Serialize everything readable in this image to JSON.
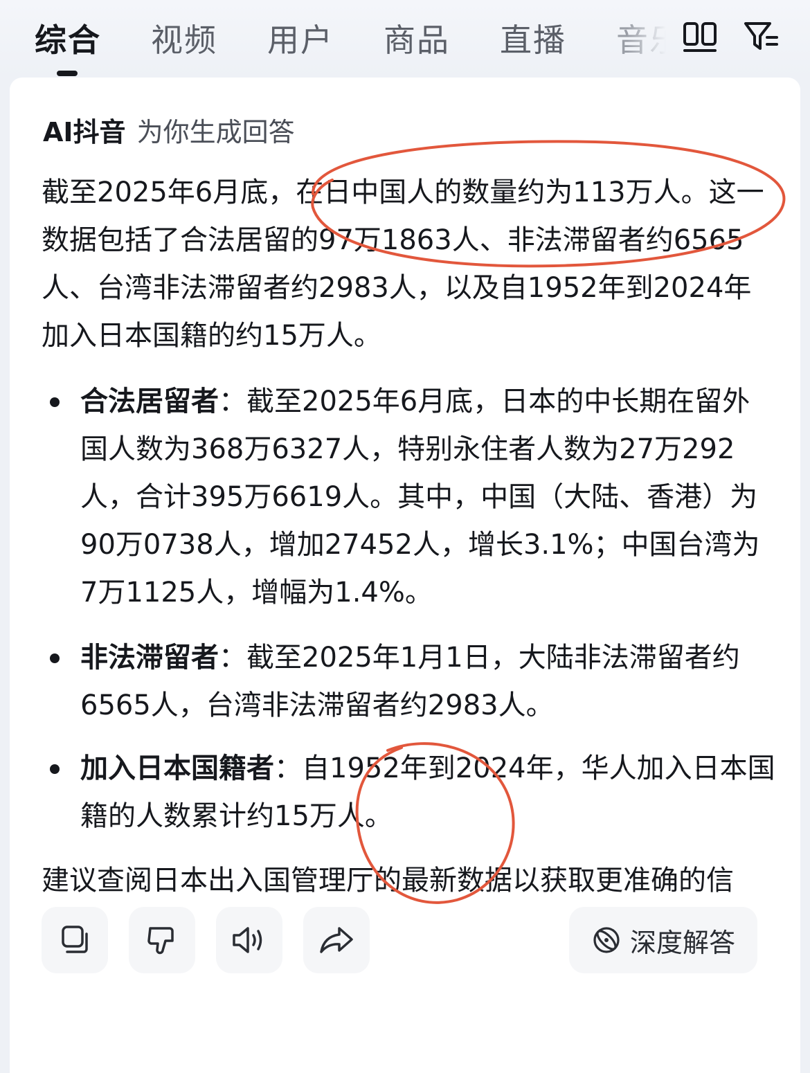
{
  "tabs": [
    {
      "label": "综合",
      "active": true
    },
    {
      "label": "视频"
    },
    {
      "label": "用户"
    },
    {
      "label": "商品"
    },
    {
      "label": "直播"
    },
    {
      "label": "音乐"
    }
  ],
  "toolbar_icons": [
    "dual-column-view-icon",
    "filter-icon"
  ],
  "answer": {
    "brand": "AI抖音",
    "subtitle": "为你生成回答",
    "intro": "截至2025年6月底，在日中国人的数量约为113万人。这一数据包括了合法居留的97万1863人、非法滞留者约6565人、台湾非法滞留者约2983人，以及自1952年到2024年加入日本国籍的约15万人。",
    "bullets": [
      {
        "title": "合法居留者",
        "text": "：截至2025年6月底，日本的中长期在留外国人数为368万6327人，特别永住者人数为27万292人，合计395万6619人。其中，中国（大陆、香港）为90万0738人，增加27452人，增长3.1%；中国台湾为7万1125人，增幅为1.4%。"
      },
      {
        "title": "非法滞留者",
        "text": "：截至2025年1月1日，大陆非法滞留者约6565人，台湾非法滞留者约2983人。"
      },
      {
        "title": "加入日本国籍者",
        "text": "：自1952年到2024年，华人加入日本国籍的人数累计约15万人。"
      }
    ],
    "closing": "建议查阅日本出入国管理厅的最新数据以获取更准确的信息。"
  },
  "actions": [
    {
      "icon": "copy-icon"
    },
    {
      "icon": "thumbs-down-icon"
    },
    {
      "icon": "speaker-icon"
    },
    {
      "icon": "share-icon"
    }
  ],
  "deep_answer": {
    "label": "深度解答",
    "icon": "deep-answer-icon"
  },
  "colors": {
    "annotation": "#e2573c",
    "text": "#16181d"
  }
}
